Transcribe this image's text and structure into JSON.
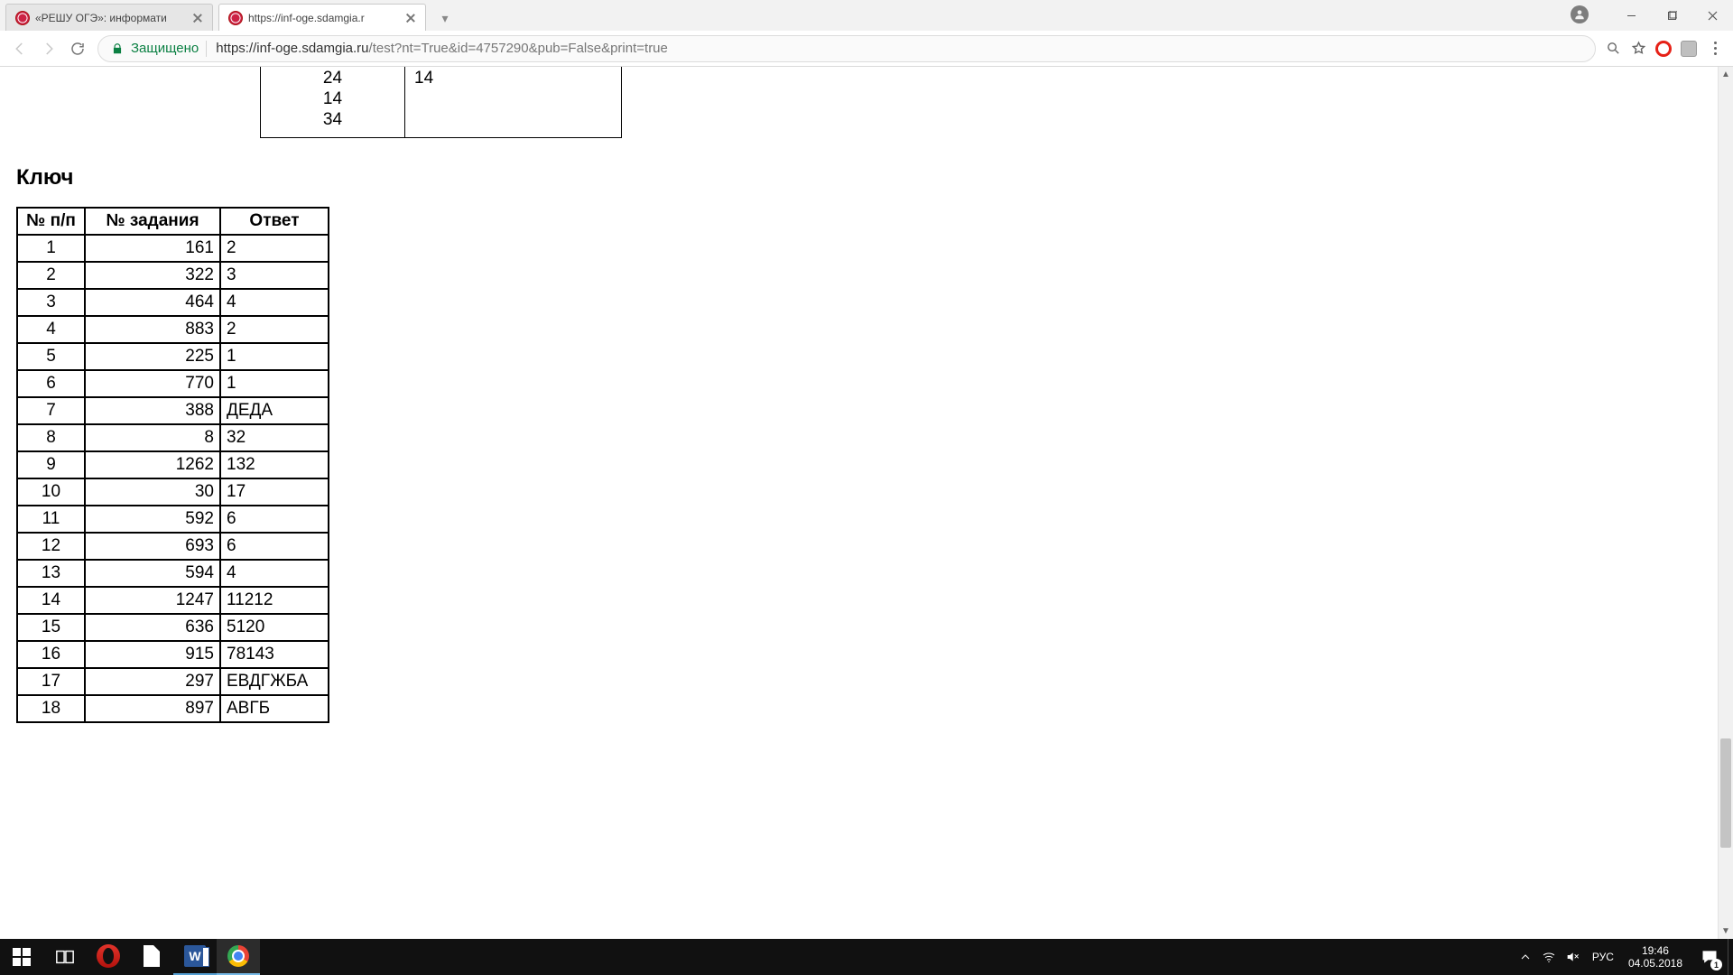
{
  "tabs": {
    "t1_title": "«РЕШУ ОГЭ»: информати",
    "t2_title": "https://inf-oge.sdamgia.r"
  },
  "omnibox": {
    "secure_label": "Защищено",
    "host": "https://inf-oge.sdamgia.ru",
    "path": "/test?nt=True&id=4757290&pub=False&print=true"
  },
  "page_top": {
    "left_cell": "24\n14\n34",
    "right_cell": "14"
  },
  "key_heading": "Ключ",
  "key_headers": {
    "n": "№ п/п",
    "tid": "№ задания",
    "ans": "Ответ"
  },
  "key_rows": [
    {
      "n": "1",
      "tid": "161",
      "ans": "2"
    },
    {
      "n": "2",
      "tid": "322",
      "ans": "3"
    },
    {
      "n": "3",
      "tid": "464",
      "ans": "4"
    },
    {
      "n": "4",
      "tid": "883",
      "ans": "2"
    },
    {
      "n": "5",
      "tid": "225",
      "ans": "1"
    },
    {
      "n": "6",
      "tid": "770",
      "ans": "1"
    },
    {
      "n": "7",
      "tid": "388",
      "ans": "ДЕДА"
    },
    {
      "n": "8",
      "tid": "8",
      "ans": "32"
    },
    {
      "n": "9",
      "tid": "1262",
      "ans": "132"
    },
    {
      "n": "10",
      "tid": "30",
      "ans": "17"
    },
    {
      "n": "11",
      "tid": "592",
      "ans": "6"
    },
    {
      "n": "12",
      "tid": "693",
      "ans": "6"
    },
    {
      "n": "13",
      "tid": "594",
      "ans": "4"
    },
    {
      "n": "14",
      "tid": "1247",
      "ans": "11212"
    },
    {
      "n": "15",
      "tid": "636",
      "ans": "5120"
    },
    {
      "n": "16",
      "tid": "915",
      "ans": "78143"
    },
    {
      "n": "17",
      "tid": "297",
      "ans": "ЕВДГЖБА"
    },
    {
      "n": "18",
      "tid": "897",
      "ans": "АВГБ"
    }
  ],
  "taskbar": {
    "lang": "РУС",
    "time": "19:46",
    "date": "04.05.2018",
    "word_glyph": "W",
    "notif_count": "1"
  }
}
